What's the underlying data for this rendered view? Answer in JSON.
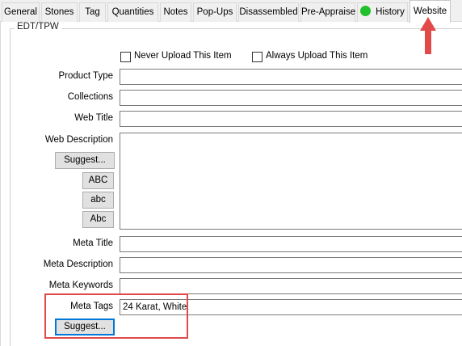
{
  "tabs": [
    {
      "label": "General"
    },
    {
      "label": "Stones"
    },
    {
      "label": "Tag"
    },
    {
      "label": "Quantities"
    },
    {
      "label": "Notes"
    },
    {
      "label": "Pop-Ups"
    },
    {
      "label": "Disassembled"
    },
    {
      "label": "Pre-Appraise"
    },
    {
      "label": "History"
    },
    {
      "label": "Website",
      "active": true
    }
  ],
  "group_title": "EDT/TPW",
  "checkboxes": {
    "never_upload": {
      "label": "Never Upload This Item",
      "checked": false
    },
    "always_upload": {
      "label": "Always Upload This Item",
      "checked": false
    }
  },
  "fields": {
    "product_type": {
      "label": "Product Type",
      "value": ""
    },
    "collections": {
      "label": "Collections",
      "value": ""
    },
    "web_title": {
      "label": "Web Title",
      "value": ""
    },
    "web_description": {
      "label": "Web Description",
      "value": ""
    },
    "meta_title": {
      "label": "Meta Title",
      "value": ""
    },
    "meta_description": {
      "label": "Meta Description",
      "value": ""
    },
    "meta_keywords": {
      "label": "Meta Keywords",
      "value": ""
    },
    "meta_tags": {
      "label": "Meta Tags",
      "value": "24 Karat, White"
    }
  },
  "buttons": {
    "suggest_description": "Suggest...",
    "upper_case": "ABC",
    "lower_case": "abc",
    "title_case": "Abc",
    "suggest_tags": "Suggest..."
  },
  "colors": {
    "history_status": "#22c02a",
    "annotation": "#e24a4a",
    "focus": "#0078d7"
  },
  "icons": {
    "history_status": "green-status-dot-icon",
    "annotation_arrow": "up-arrow-icon"
  }
}
